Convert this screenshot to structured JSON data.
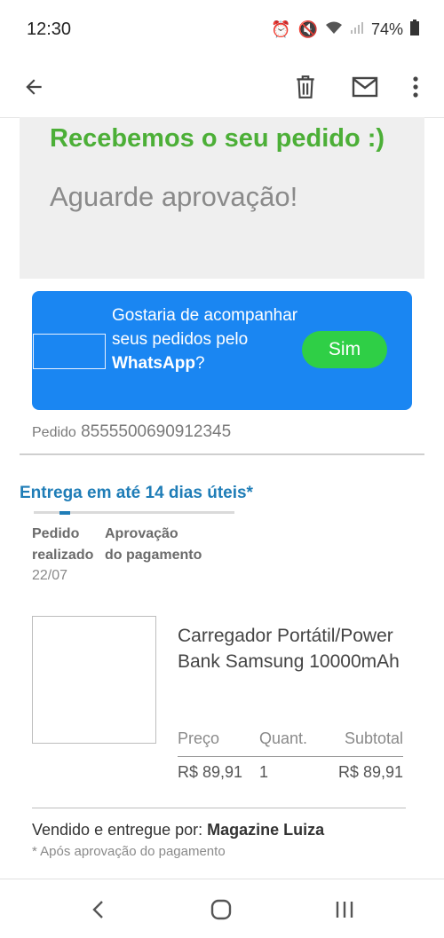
{
  "status_bar": {
    "time": "12:30",
    "battery": "74%"
  },
  "icons": {
    "back": "arrow-left-icon",
    "delete": "trash-icon",
    "mail": "mail-icon",
    "more": "more-vert-icon"
  },
  "banner": {
    "title": "Recebemos o seu pedido :)",
    "subtitle": "Aguarde aprovação!"
  },
  "whatsapp_card": {
    "text_prefix": "Gostaria de acompanhar seus pedidos pelo ",
    "text_bold": "WhatsApp",
    "text_suffix": "?",
    "yes_button": "Sim"
  },
  "order": {
    "label": "Pedido",
    "number": "8555500690912345"
  },
  "delivery": {
    "title": "Entrega em até 14 dias úteis*",
    "steps": [
      {
        "label": "Pedido realizado",
        "date": "22/07"
      },
      {
        "label": "Aprovação do pagamento",
        "date": ""
      }
    ]
  },
  "product": {
    "name": "Carregador Portátil/Power Bank Samsung 10000mAh",
    "columns": [
      "Preço",
      "Quant.",
      "Subtotal"
    ],
    "price": "R$ 89,91",
    "quantity": "1",
    "subtotal": "R$ 89,91"
  },
  "seller": {
    "label": "Vendido e entregue por: ",
    "name": "Magazine Luiza"
  },
  "note": "* Após aprovação do pagamento",
  "colors": {
    "primary_blue": "#1a86f2",
    "green": "#4caf37",
    "button_green": "#2fcf46",
    "link_blue": "#1f7db7"
  }
}
